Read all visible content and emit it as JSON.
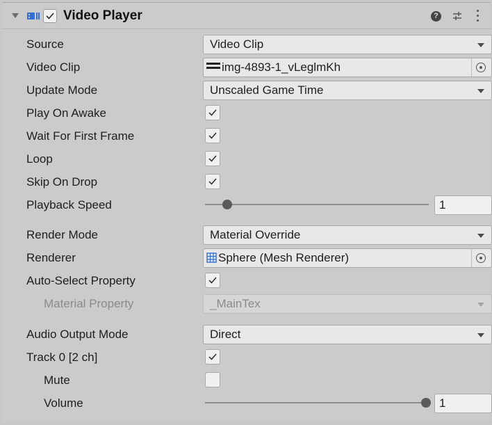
{
  "header": {
    "title": "Video Player",
    "enabled": true,
    "help_icon": "?",
    "component_icon": "video-player-icon",
    "preset_icon": "preset-sliders-icon",
    "menu_icon": "kebab-menu-icon"
  },
  "fields": {
    "source": {
      "label": "Source",
      "value": "Video Clip"
    },
    "video_clip": {
      "label": "Video Clip",
      "value": "img-4893-1_vLeglmKh"
    },
    "update_mode": {
      "label": "Update Mode",
      "value": "Unscaled Game Time"
    },
    "play_on_awake": {
      "label": "Play On Awake",
      "checked": true
    },
    "wait_first_frame": {
      "label": "Wait For First Frame",
      "checked": true
    },
    "loop": {
      "label": "Loop",
      "checked": true
    },
    "skip_on_drop": {
      "label": "Skip On Drop",
      "checked": true
    },
    "playback_speed": {
      "label": "Playback Speed",
      "value": "1",
      "slider_fraction": 0.1
    },
    "render_mode": {
      "label": "Render Mode",
      "value": "Material Override"
    },
    "renderer": {
      "label": "Renderer",
      "value": "Sphere (Mesh Renderer)"
    },
    "auto_select": {
      "label": "Auto-Select Property",
      "checked": true
    },
    "material_property": {
      "label": "Material Property",
      "value": "_MainTex"
    },
    "audio_output_mode": {
      "label": "Audio Output Mode",
      "value": "Direct"
    },
    "track0": {
      "label": "Track 0 [2 ch]",
      "checked": true
    },
    "mute": {
      "label": "Mute",
      "checked": false
    },
    "volume": {
      "label": "Volume",
      "value": "1",
      "slider_fraction": 1.0
    }
  },
  "colors": {
    "panel_bg": "#cbcbcb",
    "field_bg": "#e8e8e8",
    "icon_blue": "#2f6fd6"
  }
}
